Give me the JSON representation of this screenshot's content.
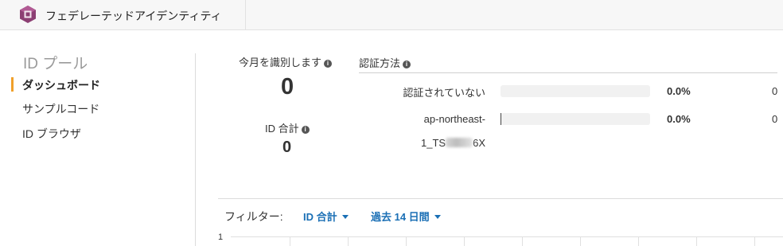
{
  "header": {
    "app_title": "フェデレーテッドアイデンティティ",
    "logo_icon": "cognito-logo-icon"
  },
  "sidebar": {
    "section_title": "ID プール",
    "items": [
      {
        "label": "ダッシュボード",
        "active": true
      },
      {
        "label": "サンプルコード",
        "active": false
      },
      {
        "label": "ID ブラウザ",
        "active": false
      }
    ],
    "active_color": "#f0a02b"
  },
  "stats": {
    "monthly_label": "今月を識別します",
    "monthly_value": "0",
    "total_label": "ID 合計",
    "total_value": "0"
  },
  "auth": {
    "title": "認証方法",
    "rows": [
      {
        "label": "認証されていない",
        "percent": "0.0%",
        "count": "0",
        "fraction": 0.0
      },
      {
        "label": "ap-northeast-",
        "label_line2_prefix": "1_TS",
        "label_line2_suffix": "6X",
        "percent": "0.0%",
        "count": "0",
        "fraction": 0.0
      }
    ]
  },
  "filter": {
    "label": "フィルター:",
    "metric": "ID 合計",
    "period": "過去 14 日間",
    "link_color": "#1a6fb5"
  },
  "chart": {
    "y_tick_top": "1"
  }
}
